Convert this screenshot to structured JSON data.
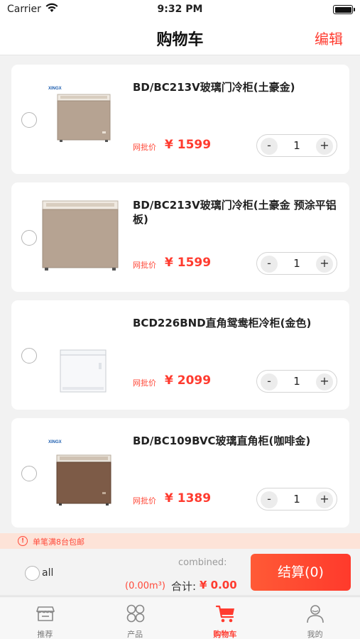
{
  "status_bar": {
    "carrier": "Carrier",
    "time": "9:32 PM"
  },
  "nav": {
    "title": "购物车",
    "edit_label": "编辑"
  },
  "cart": {
    "price_label": "网批价",
    "items": [
      {
        "name": "BD/BC213V玻璃门冷柜(土豪金)",
        "price": "¥ 1599",
        "qty": "1",
        "brand": "XINGX"
      },
      {
        "name": "BD/BC213V玻璃门冷柜(土豪金 预涂平铝板)",
        "price": "¥ 1599",
        "qty": "1",
        "brand": ""
      },
      {
        "name": "BCD226BND直角鸳鸯柜冷柜(金色)",
        "price": "¥ 2099",
        "qty": "1",
        "brand": ""
      },
      {
        "name": "BD/BC109BVC玻璃直角柜(咖啡金)",
        "price": "¥ 1389",
        "qty": "1",
        "brand": "XINGX"
      }
    ]
  },
  "stepper": {
    "minus": "-",
    "plus": "+"
  },
  "notice": {
    "text": "单笔满8台包邮",
    "icon": "warning-circle-icon"
  },
  "checkout": {
    "all_label": "all",
    "combined_label": "combined:",
    "volume": "(0.00m³)",
    "total_label": "合计:",
    "total": "¥ 0.00",
    "button_label": "结算(0)"
  },
  "tabs": [
    {
      "label": "推荐",
      "icon": "store-icon",
      "active": false
    },
    {
      "label": "产品",
      "icon": "grid-icon",
      "active": false
    },
    {
      "label": "购物车",
      "icon": "cart-icon",
      "active": true
    },
    {
      "label": "我的",
      "icon": "user-icon",
      "active": false
    }
  ],
  "colors": {
    "accent": "#ff3b2f",
    "notice_bg": "#fde3d8",
    "tab_inactive": "#777777"
  }
}
